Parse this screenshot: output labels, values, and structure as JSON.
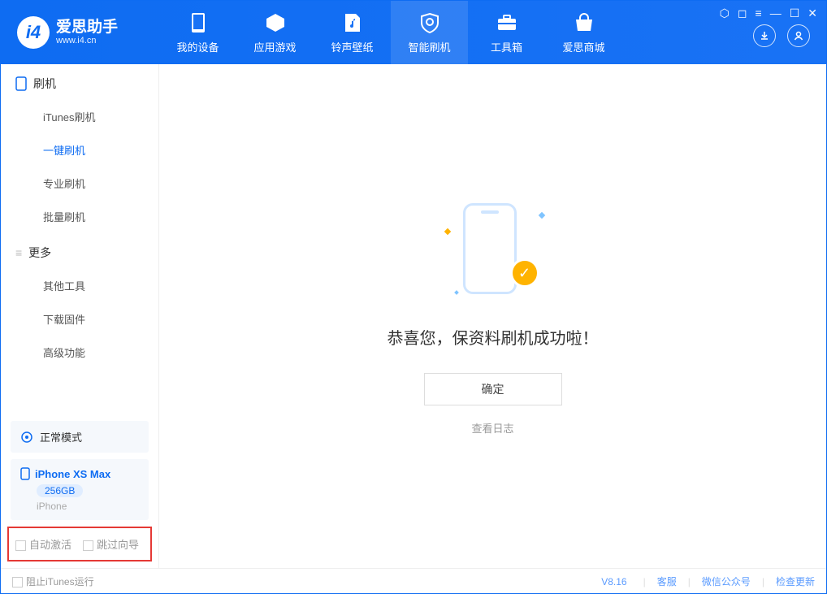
{
  "app": {
    "name_zh": "爱思助手",
    "name_en": "www.i4.cn"
  },
  "nav": {
    "tabs": [
      {
        "label": "我的设备"
      },
      {
        "label": "应用游戏"
      },
      {
        "label": "铃声壁纸"
      },
      {
        "label": "智能刷机"
      },
      {
        "label": "工具箱"
      },
      {
        "label": "爱思商城"
      }
    ]
  },
  "sidebar": {
    "section1_title": "刷机",
    "items1": [
      "iTunes刷机",
      "一键刷机",
      "专业刷机",
      "批量刷机"
    ],
    "section2_title": "更多",
    "items2": [
      "其他工具",
      "下载固件",
      "高级功能"
    ],
    "mode_label": "正常模式",
    "device": {
      "name": "iPhone XS Max",
      "capacity": "256GB",
      "type": "iPhone"
    },
    "options": {
      "auto_activate": "自动激活",
      "skip_guide": "跳过向导"
    }
  },
  "main": {
    "success_text": "恭喜您，保资料刷机成功啦！",
    "ok_button": "确定",
    "log_link": "查看日志"
  },
  "footer": {
    "block_itunes": "阻止iTunes运行",
    "version": "V8.16",
    "links": [
      "客服",
      "微信公众号",
      "检查更新"
    ]
  }
}
